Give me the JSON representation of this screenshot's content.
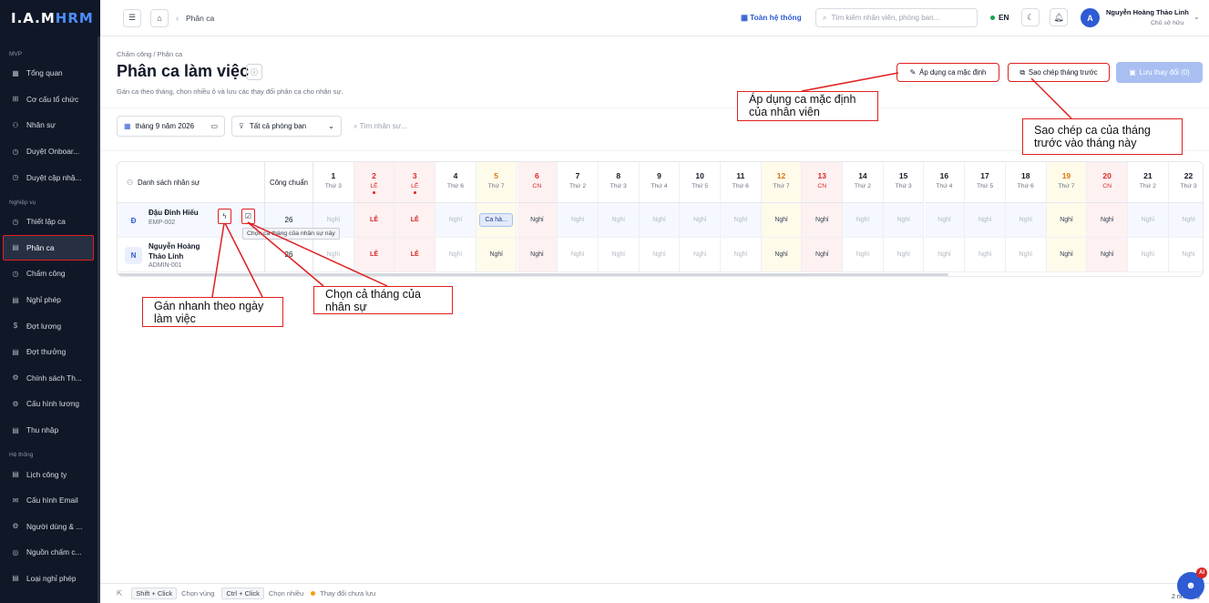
{
  "logo": {
    "part1": "I.A.M",
    "part2": "HRM"
  },
  "sidebar": {
    "sections": [
      {
        "label": "MVP",
        "items": [
          "Tổng quan",
          "Cơ cấu tổ chức",
          "Nhân sự",
          "Duyệt Onboar...",
          "Duyệt cập nhậ..."
        ]
      },
      {
        "label": "Nghiệp vụ",
        "items": [
          "Thiết lập ca",
          "Phân ca",
          "Chấm công",
          "Nghỉ phép",
          "Đợt lương",
          "Đợt thưởng",
          "Chính sách Th...",
          "Cấu hình lương",
          "Thu nhập"
        ]
      },
      {
        "label": "Hệ thống",
        "items": [
          "Lịch công ty",
          "Cấu hình Email",
          "Người dùng & ...",
          "Nguồn chấm c...",
          "Loại nghỉ phép"
        ]
      }
    ],
    "active_item": "Phân ca"
  },
  "topbar": {
    "breadcrumb": "Phân ca",
    "system_label": "Toàn hệ thống",
    "search_placeholder": "Tìm kiếm nhân viên, phòng ban...",
    "lang": "EN",
    "user_initial": "A",
    "user_name": "Nguyễn Hoàng Thảo Linh",
    "user_role": "Chủ sở hữu"
  },
  "page": {
    "breadcrumb": "Chấm công / Phân ca",
    "title": "Phân ca làm việc",
    "description": "Gán ca theo tháng, chọn nhiều ô và lưu các thay đổi phân ca cho nhân sự.",
    "btn_apply_default": "Áp dụng ca mặc định",
    "btn_copy_prev": "Sao chép tháng trước",
    "btn_save": "Lưu thay đổi (0)"
  },
  "filters": {
    "month": "tháng 9 năm 2026",
    "department": "Tất cả phòng ban",
    "search_placeholder": "Tìm nhân sư..."
  },
  "grid": {
    "name_header": "Danh sách nhân sự",
    "std_header": "Công chuẩn",
    "days": [
      {
        "d": "1",
        "w": "Thứ 3"
      },
      {
        "d": "2",
        "w": "LỄ"
      },
      {
        "d": "3",
        "w": "LỄ"
      },
      {
        "d": "4",
        "w": "Thứ 6"
      },
      {
        "d": "5",
        "w": "Thứ 7"
      },
      {
        "d": "6",
        "w": "CN"
      },
      {
        "d": "7",
        "w": "Thứ 2"
      },
      {
        "d": "8",
        "w": "Thứ 3"
      },
      {
        "d": "9",
        "w": "Thứ 4"
      },
      {
        "d": "10",
        "w": "Thứ 5"
      },
      {
        "d": "11",
        "w": "Thứ 6"
      },
      {
        "d": "12",
        "w": "Thứ 7"
      },
      {
        "d": "13",
        "w": "CN"
      },
      {
        "d": "14",
        "w": "Thứ 2"
      },
      {
        "d": "15",
        "w": "Thứ 3"
      },
      {
        "d": "16",
        "w": "Thứ 4"
      },
      {
        "d": "17",
        "w": "Thứ 5"
      },
      {
        "d": "18",
        "w": "Thứ 6"
      },
      {
        "d": "19",
        "w": "Thứ 7"
      },
      {
        "d": "20",
        "w": "CN"
      },
      {
        "d": "21",
        "w": "Thứ 2"
      },
      {
        "d": "22",
        "w": "Thứ 3"
      }
    ],
    "employees": [
      {
        "initial": "Đ",
        "name": "Đậu Đình Hiếu",
        "code": "EMP-002",
        "std": "26",
        "cells": [
          "Nghỉ",
          "LỄ",
          "LỄ",
          "Nghỉ",
          "Ca hà...",
          "Nghỉ",
          "Nghỉ",
          "Nghỉ",
          "Nghỉ",
          "Nghỉ",
          "Nghỉ",
          "Nghỉ",
          "Nghỉ",
          "Nghỉ",
          "Nghỉ",
          "Nghỉ",
          "Nghỉ",
          "Nghỉ",
          "Nghỉ",
          "Nghỉ",
          "Nghỉ",
          "Nghỉ"
        ]
      },
      {
        "initial": "N",
        "name": "Nguyễn Hoàng Thảo Linh",
        "code": "ADMIN-001",
        "std": "26",
        "cells": [
          "Nghỉ",
          "LỄ",
          "LỄ",
          "Nghỉ",
          "Nghỉ",
          "Nghỉ",
          "Nghỉ",
          "Nghỉ",
          "Nghỉ",
          "Nghỉ",
          "Nghỉ",
          "Nghỉ",
          "Nghỉ",
          "Nghỉ",
          "Nghỉ",
          "Nghỉ",
          "Nghỉ",
          "Nghỉ",
          "Nghỉ",
          "Nghỉ",
          "Nghỉ",
          "Nghỉ"
        ]
      }
    ],
    "tooltip": "Chọn cả tháng của nhân sự này"
  },
  "callouts": {
    "apply_default": "Áp dụng ca mặc định của nhân viên",
    "copy_prev": "Sao chép ca của tháng trước vào tháng này",
    "quick_assign": "Gán nhanh theo ngày làm việc",
    "select_month": "Chọn cả tháng của nhân sự"
  },
  "bottom": {
    "shift_key": "Shift + Click",
    "shift_label": "Chọn vùng",
    "ctrl_key": "Ctrl + Click",
    "ctrl_label": "Chọn nhiều",
    "unsaved": "Thay đổi chưa lưu",
    "corner_text": "2 nhân sự",
    "ai_badge": "AI"
  },
  "colors": {
    "accent": "#2f5bd3",
    "holiday": "#dc2626",
    "saturday": "#d97706",
    "callout_border": "#e02020"
  }
}
